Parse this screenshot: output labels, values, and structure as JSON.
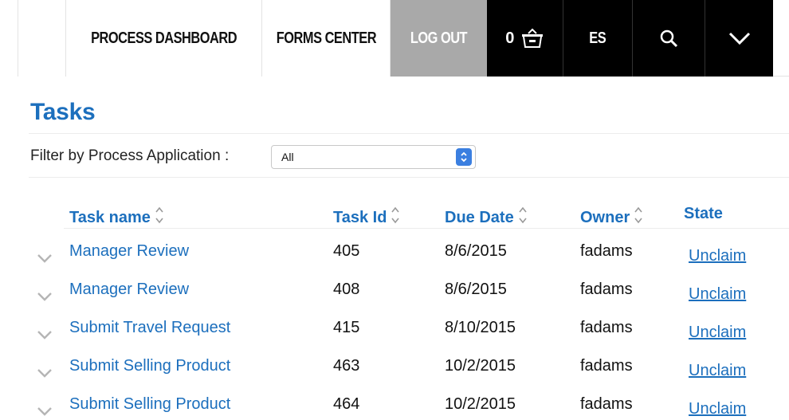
{
  "nav": {
    "process_dashboard": "PROCESS DASHBOARD",
    "forms_center": "FORMS CENTER",
    "log_out": "LOG OUT",
    "cart_count": "0",
    "language": "ES",
    "cart_icon": "basket-icon",
    "search_icon": "search-icon",
    "menu_icon": "chevron-down-icon"
  },
  "page": {
    "title": "Tasks"
  },
  "filter": {
    "label": "Filter by Process Application :",
    "selected": "All"
  },
  "table": {
    "headers": [
      "Task name",
      "Task Id",
      "Due Date",
      "Owner",
      "State"
    ],
    "rows": [
      {
        "name": "Manager Review",
        "id": "405",
        "due": "8/6/2015",
        "owner": "fadams",
        "state": "Unclaim"
      },
      {
        "name": "Manager Review",
        "id": "408",
        "due": "8/6/2015",
        "owner": "fadams",
        "state": "Unclaim"
      },
      {
        "name": "Submit Travel Request",
        "id": "415",
        "due": "8/10/2015",
        "owner": "fadams",
        "state": "Unclaim"
      },
      {
        "name": "Submit Selling Product",
        "id": "463",
        "due": "10/2/2015",
        "owner": "fadams",
        "state": "Unclaim"
      },
      {
        "name": "Submit Selling Product",
        "id": "464",
        "due": "10/2/2015",
        "owner": "fadams",
        "state": "Unclaim"
      }
    ]
  },
  "colors": {
    "accent": "#1c6fbd",
    "logout_bg": "#a9a9a9",
    "dark_bg": "#000000"
  }
}
